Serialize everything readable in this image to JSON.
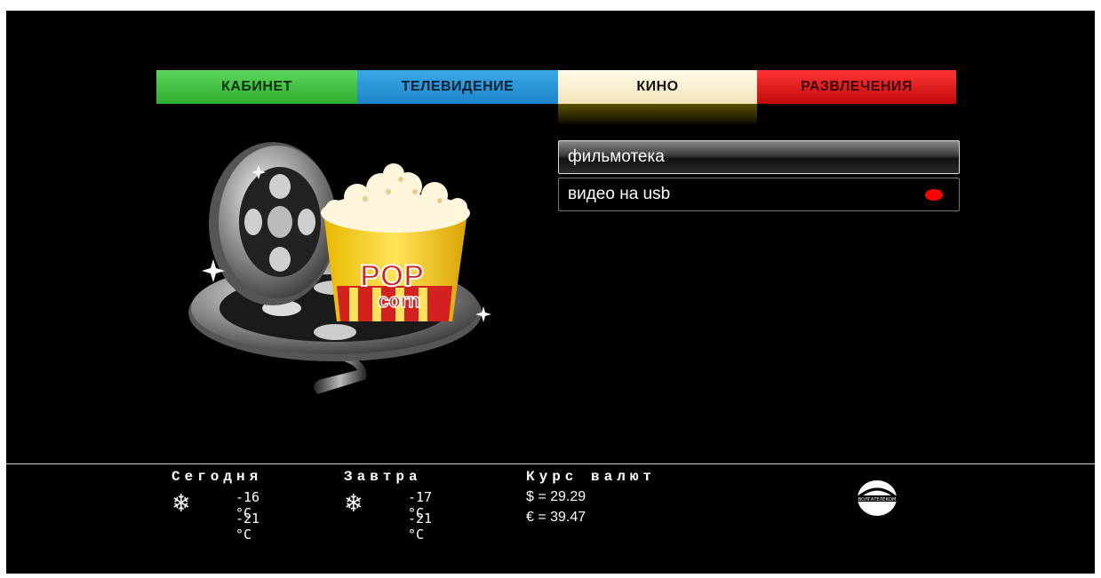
{
  "tabs": [
    {
      "label": "КАБИНЕТ",
      "color": "#2fae2f"
    },
    {
      "label": "ТЕЛЕВИДЕНИЕ",
      "color": "#1d84c7"
    },
    {
      "label": "КИНО",
      "color": "#fffbe8",
      "active": true
    },
    {
      "label": "РАЗВЛЕЧЕНИЯ",
      "color": "#e01010"
    }
  ],
  "menu": {
    "items": [
      {
        "label": "фильмотека",
        "selected": true
      },
      {
        "label": "видео на usb",
        "indicator": "red-dot"
      }
    ]
  },
  "illustration": {
    "popcorn_text_top": "POP",
    "popcorn_text_bottom": "corn"
  },
  "weather": {
    "today": {
      "heading": "Сегодня",
      "high": "-16 °C",
      "low": "-21 °C",
      "icon": "snowflake-icon"
    },
    "tomorrow": {
      "heading": "Завтра",
      "high": "-17 °C",
      "low": "-21 °C",
      "icon": "snowflake-icon"
    }
  },
  "currency": {
    "heading": "Курс валют",
    "usd": "$ = 29.29",
    "eur": "€ = 39.47"
  },
  "logo": {
    "text": "ВОЛГАТЕЛЕКОМ"
  }
}
